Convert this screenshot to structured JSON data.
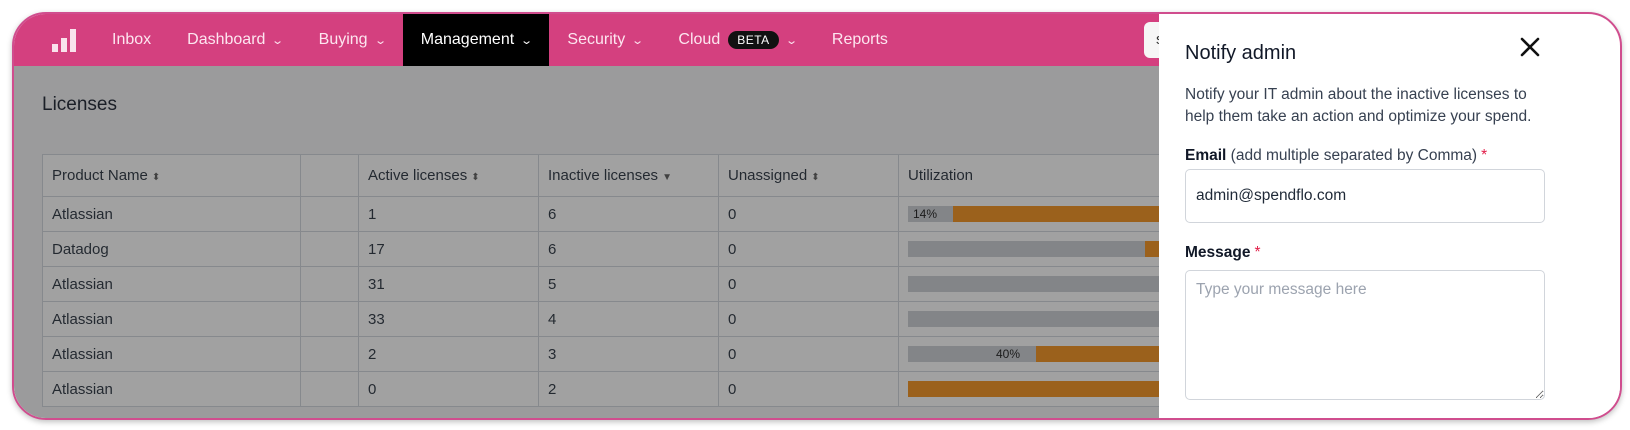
{
  "nav": {
    "logo_icon": "bar-chart-logo-icon",
    "items": [
      {
        "label": "Inbox",
        "dropdown": false
      },
      {
        "label": "Dashboard",
        "dropdown": true
      },
      {
        "label": "Buying",
        "dropdown": true
      },
      {
        "label": "Management",
        "dropdown": true,
        "active": true
      },
      {
        "label": "Security",
        "dropdown": true
      },
      {
        "label": "Cloud",
        "dropdown": true,
        "badge": "BETA"
      },
      {
        "label": "Reports",
        "dropdown": false
      }
    ],
    "search_value": "spendflo"
  },
  "page": {
    "title": "Licenses",
    "table": {
      "headers": [
        "Product Name",
        "",
        "Active licenses",
        "Inactive licenses",
        "Unassigned",
        "Utilization"
      ],
      "rows": [
        {
          "product": "Atlassian",
          "active": "1",
          "inactive": "6",
          "unassigned": "0",
          "utilization_label": "14%",
          "utilization": 0.14
        },
        {
          "product": "Datadog",
          "active": "17",
          "inactive": "6",
          "unassigned": "0",
          "utilization_label": "",
          "utilization": 0.74
        },
        {
          "product": "Atlassian",
          "active": "31",
          "inactive": "5",
          "unassigned": "0",
          "utilization_label": "",
          "utilization": 0.86
        },
        {
          "product": "Atlassian",
          "active": "33",
          "inactive": "4",
          "unassigned": "0",
          "utilization_label": "",
          "utilization": 0.89
        },
        {
          "product": "Atlassian",
          "active": "2",
          "inactive": "3",
          "unassigned": "0",
          "utilization_label": "40%",
          "utilization": 0.4
        },
        {
          "product": "Atlassian",
          "active": "0",
          "inactive": "2",
          "unassigned": "0",
          "utilization_label": "",
          "utilization": 0.0
        }
      ]
    }
  },
  "panel": {
    "title": "Notify admin",
    "description": "Notify your IT admin about the inactive licenses to help them take an action and optimize your spend.",
    "email_label": "Email",
    "email_hint": "(add multiple separated by Comma)",
    "email_value": "admin@spendflo.com",
    "message_label": "Message",
    "message_placeholder": "Type your message here",
    "required_mark": "*"
  },
  "colors": {
    "nav_bg": "#d4407f",
    "active_bg": "#000000",
    "bar_fill": "#f48d12",
    "bar_track": "#c9cdd3",
    "required": "#e11d48",
    "frame_border": "#d04d8e"
  }
}
